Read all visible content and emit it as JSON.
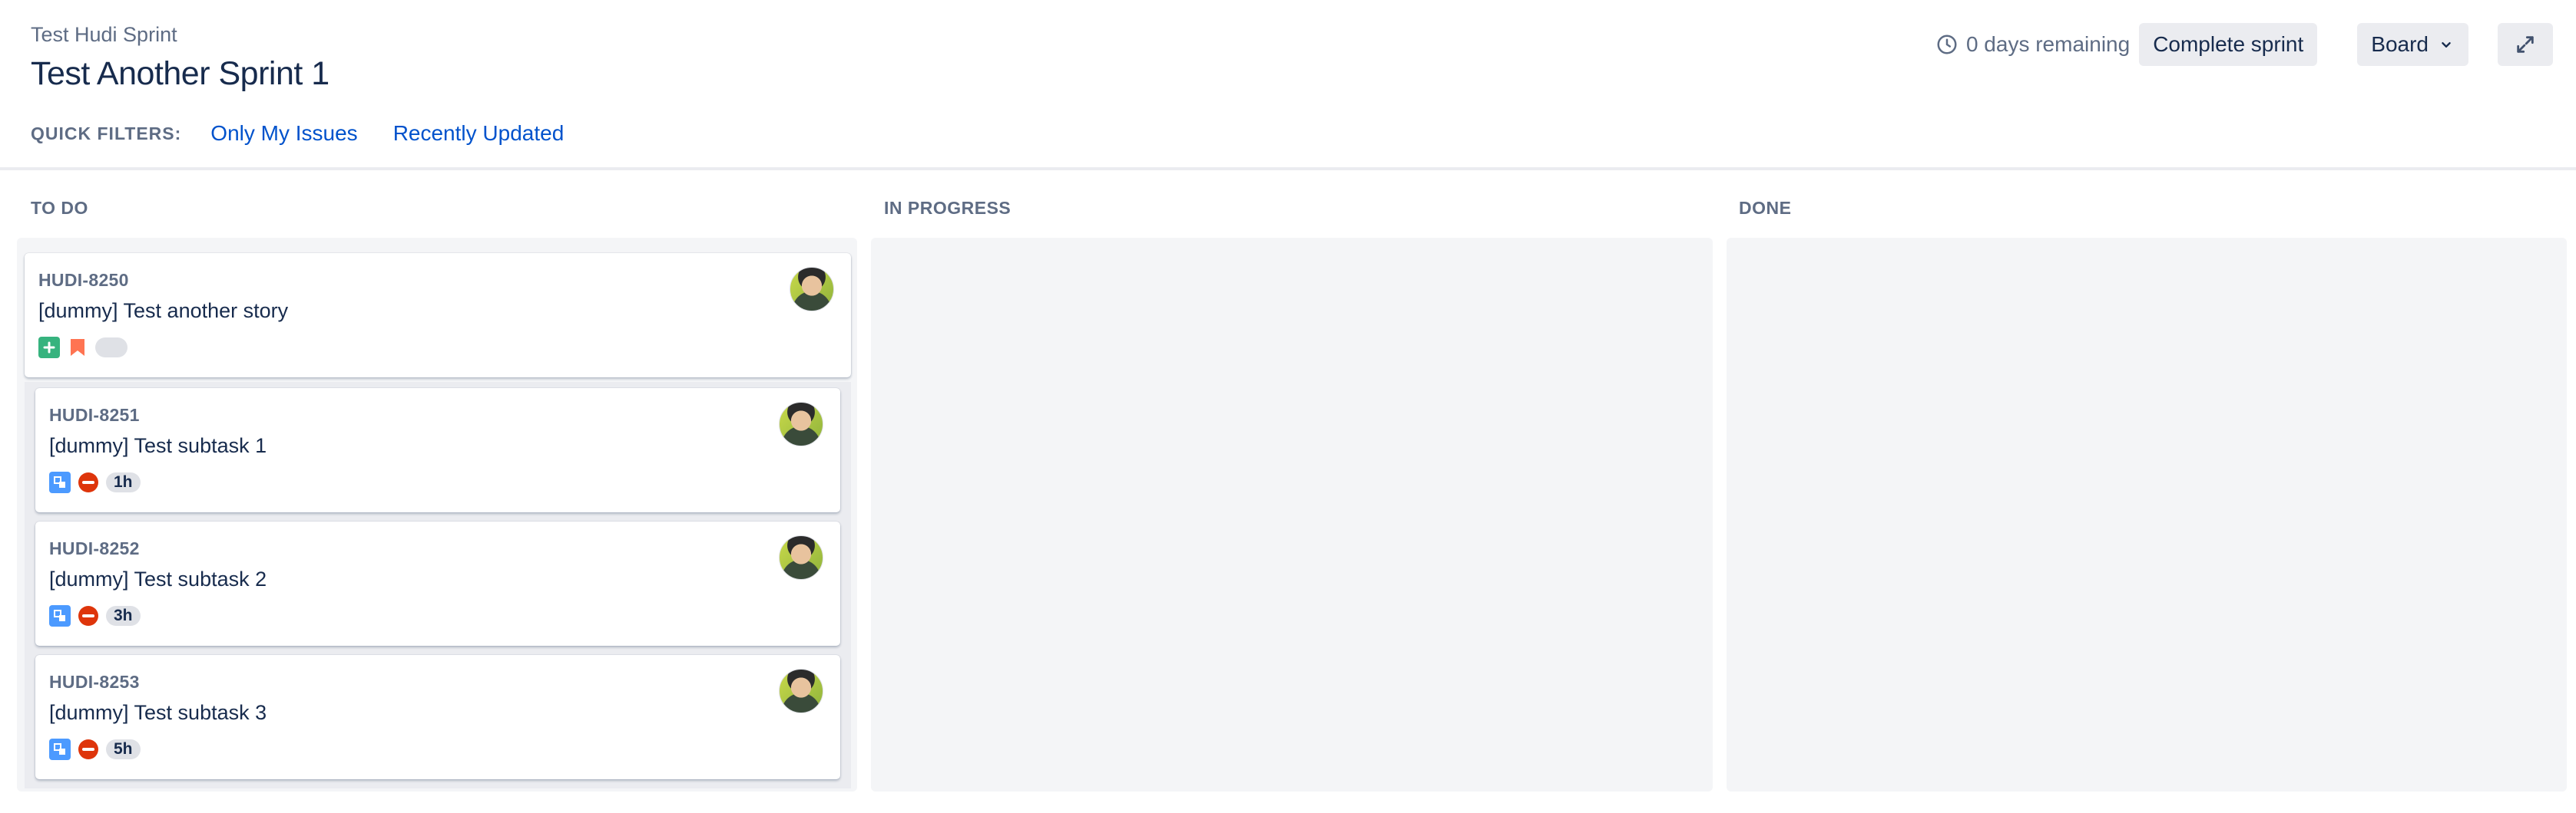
{
  "header": {
    "project_name": "Test Hudi Sprint",
    "sprint_title": "Test Another Sprint 1",
    "remaining": "0 days remaining",
    "complete_sprint_label": "Complete sprint",
    "board_label": "Board"
  },
  "quick_filters": {
    "label": "QUICK FILTERS:",
    "items": [
      "Only My Issues",
      "Recently Updated"
    ]
  },
  "columns": [
    {
      "title": "TO DO"
    },
    {
      "title": "IN PROGRESS"
    },
    {
      "title": "DONE"
    }
  ],
  "parent_card": {
    "key": "HUDI-8250",
    "summary": "[dummy] Test another story",
    "type_icon": "story-icon",
    "priority_icon": "priority-high-icon",
    "estimate": ""
  },
  "subtasks": [
    {
      "key": "HUDI-8251",
      "summary": "[dummy] Test subtask 1",
      "type_icon": "subtask-icon",
      "priority_icon": "blocker-icon",
      "estimate": "1h"
    },
    {
      "key": "HUDI-8252",
      "summary": "[dummy] Test subtask 2",
      "type_icon": "subtask-icon",
      "priority_icon": "blocker-icon",
      "estimate": "3h"
    },
    {
      "key": "HUDI-8253",
      "summary": "[dummy] Test subtask 3",
      "type_icon": "subtask-icon",
      "priority_icon": "blocker-icon",
      "estimate": "5h"
    }
  ],
  "colors": {
    "link": "#0052cc",
    "story": "#36b37e",
    "subtask": "#4c9aff",
    "blocker": "#de350b",
    "priority": "#ff7452",
    "column_bg": "#f4f5f7"
  }
}
